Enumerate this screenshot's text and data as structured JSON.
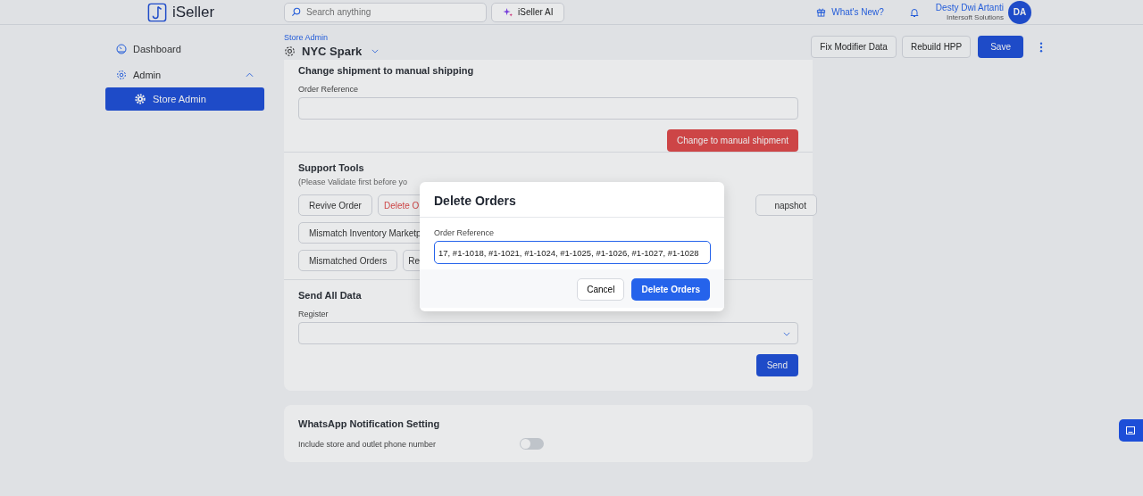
{
  "header": {
    "logo": "iSeller",
    "search": {
      "placeholder": "Search anything"
    },
    "ai_button": "iSeller AI",
    "whats_new": "What's New?",
    "user": {
      "name": "Desty Dwi Artanti",
      "company": "Intersoft Solutions",
      "initials": "DA"
    }
  },
  "sidebar": {
    "items": [
      {
        "label": "Dashboard",
        "selected": false,
        "kind": "dashboard"
      },
      {
        "label": "Admin",
        "selected": false,
        "kind": "gear",
        "expanded": true,
        "children": [
          {
            "label": "Store Admin",
            "selected": true
          }
        ]
      }
    ]
  },
  "page": {
    "breadcrumb": "Store Admin",
    "title": "NYC Spark",
    "actions": [
      {
        "label": "Fix Modifier Data",
        "kind": "outline"
      },
      {
        "label": "Rebuild HPP",
        "kind": "outline"
      },
      {
        "label": "Save",
        "kind": "primary"
      }
    ]
  },
  "manual_shipping": {
    "title": "Change shipment to manual shipping",
    "field_label": "Order Reference",
    "button": "Change to manual shipment"
  },
  "support_tools": {
    "title": "Support Tools",
    "note": "(Please Validate first before yo",
    "rows": [
      [
        {
          "label": "Revive Order",
          "kind": "normal"
        },
        {
          "label": "Delete O",
          "kind": "danger"
        },
        {
          "label": "napshot",
          "kind": "tail"
        }
      ],
      [
        {
          "label": "Mismatch Inventory Marketp",
          "kind": "normal"
        }
      ],
      [
        {
          "label": "Mismatched Orders",
          "kind": "normal"
        },
        {
          "label": "Re",
          "kind": "clipped"
        }
      ]
    ]
  },
  "send_all": {
    "title": "Send All Data",
    "field_label": "Register",
    "button": "Send"
  },
  "whatsapp": {
    "title": "WhatsApp Notification Setting",
    "label": "Include store and outlet phone number",
    "on": false
  },
  "dialog": {
    "title": "Delete Orders",
    "field_label": "Order Reference",
    "value": "17, #1-1018, #1-1021, #1-1024, #1-1025, #1-1026, #1-1027, #1-1028",
    "cancel": "Cancel",
    "confirm": "Delete Orders"
  }
}
